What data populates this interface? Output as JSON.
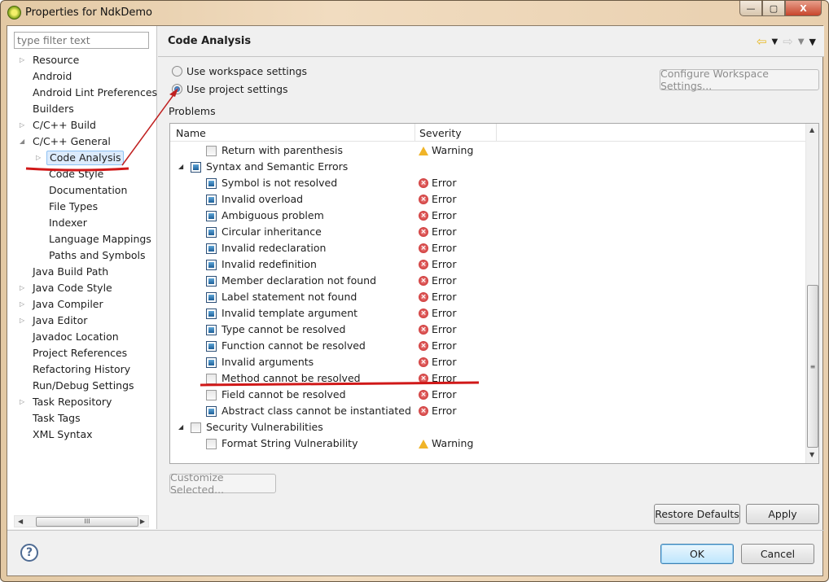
{
  "window": {
    "title": "Properties for NdkDemo",
    "minimize": "—",
    "maximize": "▢",
    "close": "X"
  },
  "sidebar": {
    "filter_placeholder": "type filter text",
    "items": [
      {
        "label": "Resource",
        "level": 0,
        "expander": "collapsed"
      },
      {
        "label": "Android",
        "level": 0
      },
      {
        "label": "Android Lint Preferences",
        "level": 0
      },
      {
        "label": "Builders",
        "level": 0
      },
      {
        "label": "C/C++ Build",
        "level": 0,
        "expander": "collapsed"
      },
      {
        "label": "C/C++ General",
        "level": 0,
        "expander": "expanded"
      },
      {
        "label": "Code Analysis",
        "level": 1,
        "expander": "collapsed",
        "selected": true
      },
      {
        "label": "Code Style",
        "level": 1
      },
      {
        "label": "Documentation",
        "level": 1
      },
      {
        "label": "File Types",
        "level": 1
      },
      {
        "label": "Indexer",
        "level": 1
      },
      {
        "label": "Language Mappings",
        "level": 1
      },
      {
        "label": "Paths and Symbols",
        "level": 1
      },
      {
        "label": "Java Build Path",
        "level": 0
      },
      {
        "label": "Java Code Style",
        "level": 0,
        "expander": "collapsed"
      },
      {
        "label": "Java Compiler",
        "level": 0,
        "expander": "collapsed"
      },
      {
        "label": "Java Editor",
        "level": 0,
        "expander": "collapsed"
      },
      {
        "label": "Javadoc Location",
        "level": 0
      },
      {
        "label": "Project References",
        "level": 0
      },
      {
        "label": "Refactoring History",
        "level": 0
      },
      {
        "label": "Run/Debug Settings",
        "level": 0
      },
      {
        "label": "Task Repository",
        "level": 0,
        "expander": "collapsed"
      },
      {
        "label": "Task Tags",
        "level": 0
      },
      {
        "label": "XML Syntax",
        "level": 0
      }
    ],
    "hscroll_grip": "III"
  },
  "main": {
    "title": "Code Analysis",
    "radio_workspace": "Use workspace settings",
    "radio_project": "Use project settings",
    "selected_radio": "project",
    "configure_button": "Configure Workspace Settings...",
    "problems_label": "Problems",
    "columns": [
      "Name",
      "Severity"
    ],
    "rows": [
      {
        "name": "Return with parenthesis",
        "level": 1,
        "checked": false,
        "severity": "Warning"
      },
      {
        "name": "Syntax and Semantic Errors",
        "level": 0,
        "checked": true,
        "expander": "expanded"
      },
      {
        "name": "Symbol is not resolved",
        "level": 1,
        "checked": true,
        "severity": "Error"
      },
      {
        "name": "Invalid overload",
        "level": 1,
        "checked": true,
        "severity": "Error"
      },
      {
        "name": "Ambiguous problem",
        "level": 1,
        "checked": true,
        "severity": "Error"
      },
      {
        "name": "Circular inheritance",
        "level": 1,
        "checked": true,
        "severity": "Error"
      },
      {
        "name": "Invalid redeclaration",
        "level": 1,
        "checked": true,
        "severity": "Error"
      },
      {
        "name": "Invalid redefinition",
        "level": 1,
        "checked": true,
        "severity": "Error"
      },
      {
        "name": "Member declaration not found",
        "level": 1,
        "checked": true,
        "severity": "Error"
      },
      {
        "name": "Label statement not found",
        "level": 1,
        "checked": true,
        "severity": "Error"
      },
      {
        "name": "Invalid template argument",
        "level": 1,
        "checked": true,
        "severity": "Error"
      },
      {
        "name": "Type cannot be resolved",
        "level": 1,
        "checked": true,
        "severity": "Error"
      },
      {
        "name": "Function cannot be resolved",
        "level": 1,
        "checked": true,
        "severity": "Error"
      },
      {
        "name": "Invalid arguments",
        "level": 1,
        "checked": true,
        "severity": "Error"
      },
      {
        "name": "Method cannot be resolved",
        "level": 1,
        "checked": false,
        "severity": "Error"
      },
      {
        "name": "Field cannot be resolved",
        "level": 1,
        "checked": false,
        "severity": "Error"
      },
      {
        "name": "Abstract class cannot be instantiated",
        "level": 1,
        "checked": true,
        "severity": "Error"
      },
      {
        "name": "Security Vulnerabilities",
        "level": 0,
        "checked": false,
        "expander": "expanded"
      },
      {
        "name": "Format String Vulnerability",
        "level": 1,
        "checked": false,
        "severity": "Warning"
      }
    ],
    "vscroll_grip": "≡",
    "customize_button": "Customize Selected...",
    "restore_button": "Restore Defaults",
    "apply_button": "Apply"
  },
  "footer": {
    "help": "?",
    "ok": "OK",
    "cancel": "Cancel"
  },
  "colors": {
    "annotation": "#d01818",
    "selection": "#dcebfc",
    "error": "#c21a1a",
    "warning": "#f0b428"
  }
}
